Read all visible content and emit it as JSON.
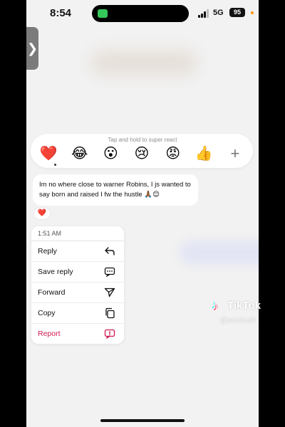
{
  "status_bar": {
    "time": "8:54",
    "network": "5G",
    "battery": "95"
  },
  "side_tab": {
    "glyph": "❯"
  },
  "reactions": {
    "hint": "Tap and hold to super react",
    "emojis": [
      "❤️",
      "😂",
      "😮",
      "😢",
      "😡",
      "👍"
    ],
    "add_glyph": "+"
  },
  "message": {
    "text": "Im no where close to warner Robins, I js wanted to say born and raised I fw the hustle 🙏🏾😊",
    "reaction": "❤️"
  },
  "menu": {
    "timestamp": "1:51 AM",
    "items": [
      {
        "label": "Reply",
        "icon": "reply-icon"
      },
      {
        "label": "Save reply",
        "icon": "chat-bubble-icon"
      },
      {
        "label": "Forward",
        "icon": "send-icon"
      },
      {
        "label": "Copy",
        "icon": "copy-icon"
      },
      {
        "label": "Report",
        "icon": "report-icon"
      }
    ]
  },
  "watermark": {
    "brand": "TikTok",
    "handle": "@amstxntii"
  },
  "colors": {
    "accent_report": "#d1164e",
    "background": "#f2f2f2",
    "battery_indicator": "#34c759"
  }
}
